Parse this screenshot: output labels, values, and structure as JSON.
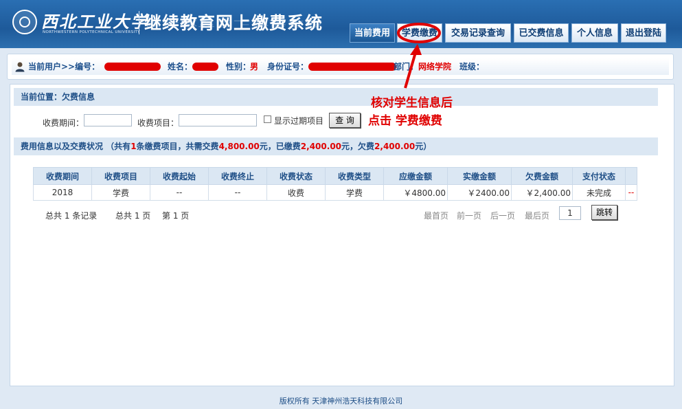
{
  "header": {
    "university_name": "西北工业大学",
    "university_name_en": "NORTHWESTERN POLYTECHNICAL UNIVERSITY",
    "system_title": "继续教育网上缴费系统",
    "nav": [
      "当前费用",
      "学费缴费",
      "交易记录查询",
      "已交费信息",
      "个人信息",
      "退出登陆"
    ],
    "active_nav": "当前费用"
  },
  "user_bar": {
    "current_user": "当前用户>>编号：",
    "name_label": "姓名：",
    "gender_label": "性别：",
    "gender_value": "男",
    "id_label": "身份证号：",
    "dept_label": "部门：",
    "dept_value": "网络学院",
    "class_label": "班级："
  },
  "location": "当前位置：欠费信息",
  "search": {
    "period_label": "收费期间：",
    "item_label": "收费项目：",
    "show_expired_label": "显示过期项目",
    "query_button": "查 询"
  },
  "summary": {
    "prefix": "费用信息以及交费状况  （共有",
    "count": "1",
    "mid1": "条缴费项目，共需交费",
    "total": "4,800.00",
    "mid2": "元，已缴费",
    "paid": "2,400.00",
    "mid3": "元，欠费",
    "owed": "2,400.00",
    "suffix": "元）"
  },
  "table": {
    "columns": [
      "收费期间",
      "收费项目",
      "收费起始",
      "收费终止",
      "收费状态",
      "收费类型",
      "应缴金额",
      "实缴金额",
      "欠费金额",
      "支付状态",
      ""
    ],
    "rows": [
      [
        "2018",
        "学费",
        "--",
        "--",
        "收费",
        "学费",
        "￥4800.00",
        "￥2400.00",
        "￥2,400.00",
        "未完成",
        "--"
      ]
    ]
  },
  "pagination": {
    "total_records": "总共  1 条记录",
    "total_pages": "总共  1 页",
    "current_page": "第 1 页",
    "first": "最首页",
    "prev": "前一页",
    "next": "后一页",
    "last": "最后页",
    "page_input": "1",
    "jump_button": "跳转"
  },
  "annotation": {
    "line1": "核对学生信息后",
    "line2": "点击  学费缴费"
  },
  "footer": "版权所有 天津神州浩天科技有限公司",
  "colors": {
    "header_blue": "#1e5a9a",
    "highlight_red": "#e00000",
    "section_bg": "#dbe7f3"
  }
}
